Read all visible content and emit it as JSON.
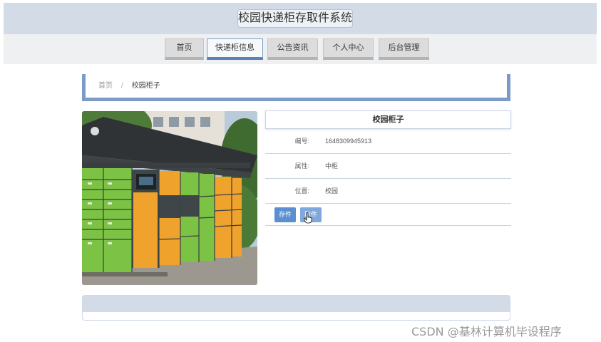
{
  "header": {
    "title": "校园快递柜存取件系统"
  },
  "nav": {
    "items": [
      {
        "label": "首页"
      },
      {
        "label": "快递柜信息",
        "active": true
      },
      {
        "label": "公告资讯"
      },
      {
        "label": "个人中心"
      },
      {
        "label": "后台管理"
      }
    ]
  },
  "breadcrumb": {
    "home": "首页",
    "separator": "/",
    "current": "校园柜子"
  },
  "detail": {
    "name": "校园柜子",
    "fields": [
      {
        "label": "编号:",
        "value": "1648309945913"
      },
      {
        "label": "属性:",
        "value": "中柜"
      },
      {
        "label": "位置:",
        "value": "校园"
      }
    ],
    "actions": {
      "store": "存件",
      "take": "取件"
    }
  },
  "watermark": "CSDN @基林计算机毕设程序",
  "colors": {
    "accent": "#7c9bc7",
    "button": "#5b8fd1",
    "header_bg": "#d2dbe6"
  },
  "image": {
    "subject": "outdoor smart parcel locker with green and orange doors"
  }
}
